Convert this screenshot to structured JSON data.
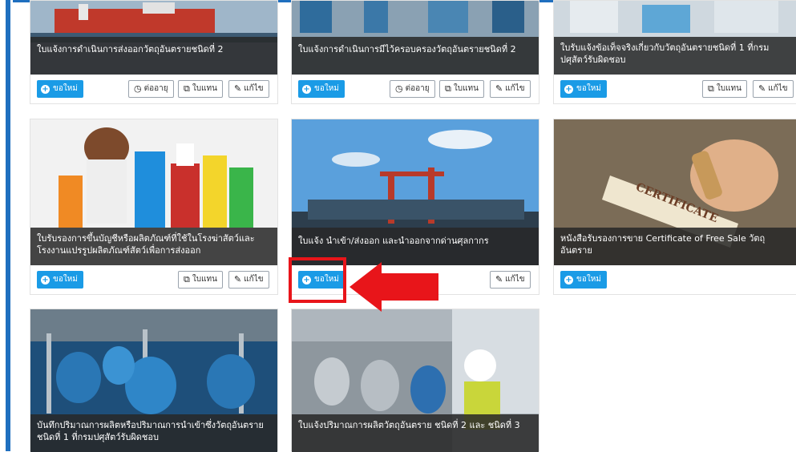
{
  "labels": {
    "request_new": "ขอใหม่",
    "renew": "ต่ออายุ",
    "replacement": "ใบแทน",
    "edit": "แก้ไข"
  },
  "icons": {
    "request_new": "plus-circle-icon",
    "renew": "clock-icon",
    "replacement": "copy-icon",
    "edit": "pencil-icon"
  },
  "colors": {
    "accent": "#1a9be6",
    "highlight": "#e8151a",
    "caption_bg": "#282828"
  },
  "cards": [
    {
      "title": "ใบแจ้งการดำเนินการส่งออกวัตถุอันตรายชนิดที่ 2"
    },
    {
      "title": "ใบแจ้งการดำเนินการมีไว้ครอบครองวัตถุอันตรายชนิดที่ 2"
    },
    {
      "title": "ใบรับแจ้งข้อเท็จจริงเกี่ยวกับวัตถุอันตรายชนิดที่ 1 ที่กรมปศุสัตว์รับผิดชอบ"
    },
    {
      "title": "ใบรับรองการขึ้นบัญชีหรือผลิตภัณฑ์ที่ใช้ในโรงฆ่าสัตว์และโรงงานแปรรูปผลิตภัณฑ์สัตว์เพื่อการส่งออก"
    },
    {
      "title": "ใบแจ้ง นำเข้า/ส่งออก และนำออกจากด่านศุลกากร"
    },
    {
      "title": "หนังสือรับรองการขาย Certificate of Free Sale วัตถุอันตราย",
      "image_text": "CERTIFICATE"
    },
    {
      "title": "บันทึกปริมาณการผลิตหรือปริมาณการนำเข้าซึ่งวัตถุอันตรายชนิดที่ 1 ที่กรมปศุสัตว์รับผิดชอบ"
    },
    {
      "title": "ใบแจ้งปริมาณการผลิตวัตถุอันตราย ชนิดที่ 2 และ ชนิดที่ 3"
    }
  ]
}
